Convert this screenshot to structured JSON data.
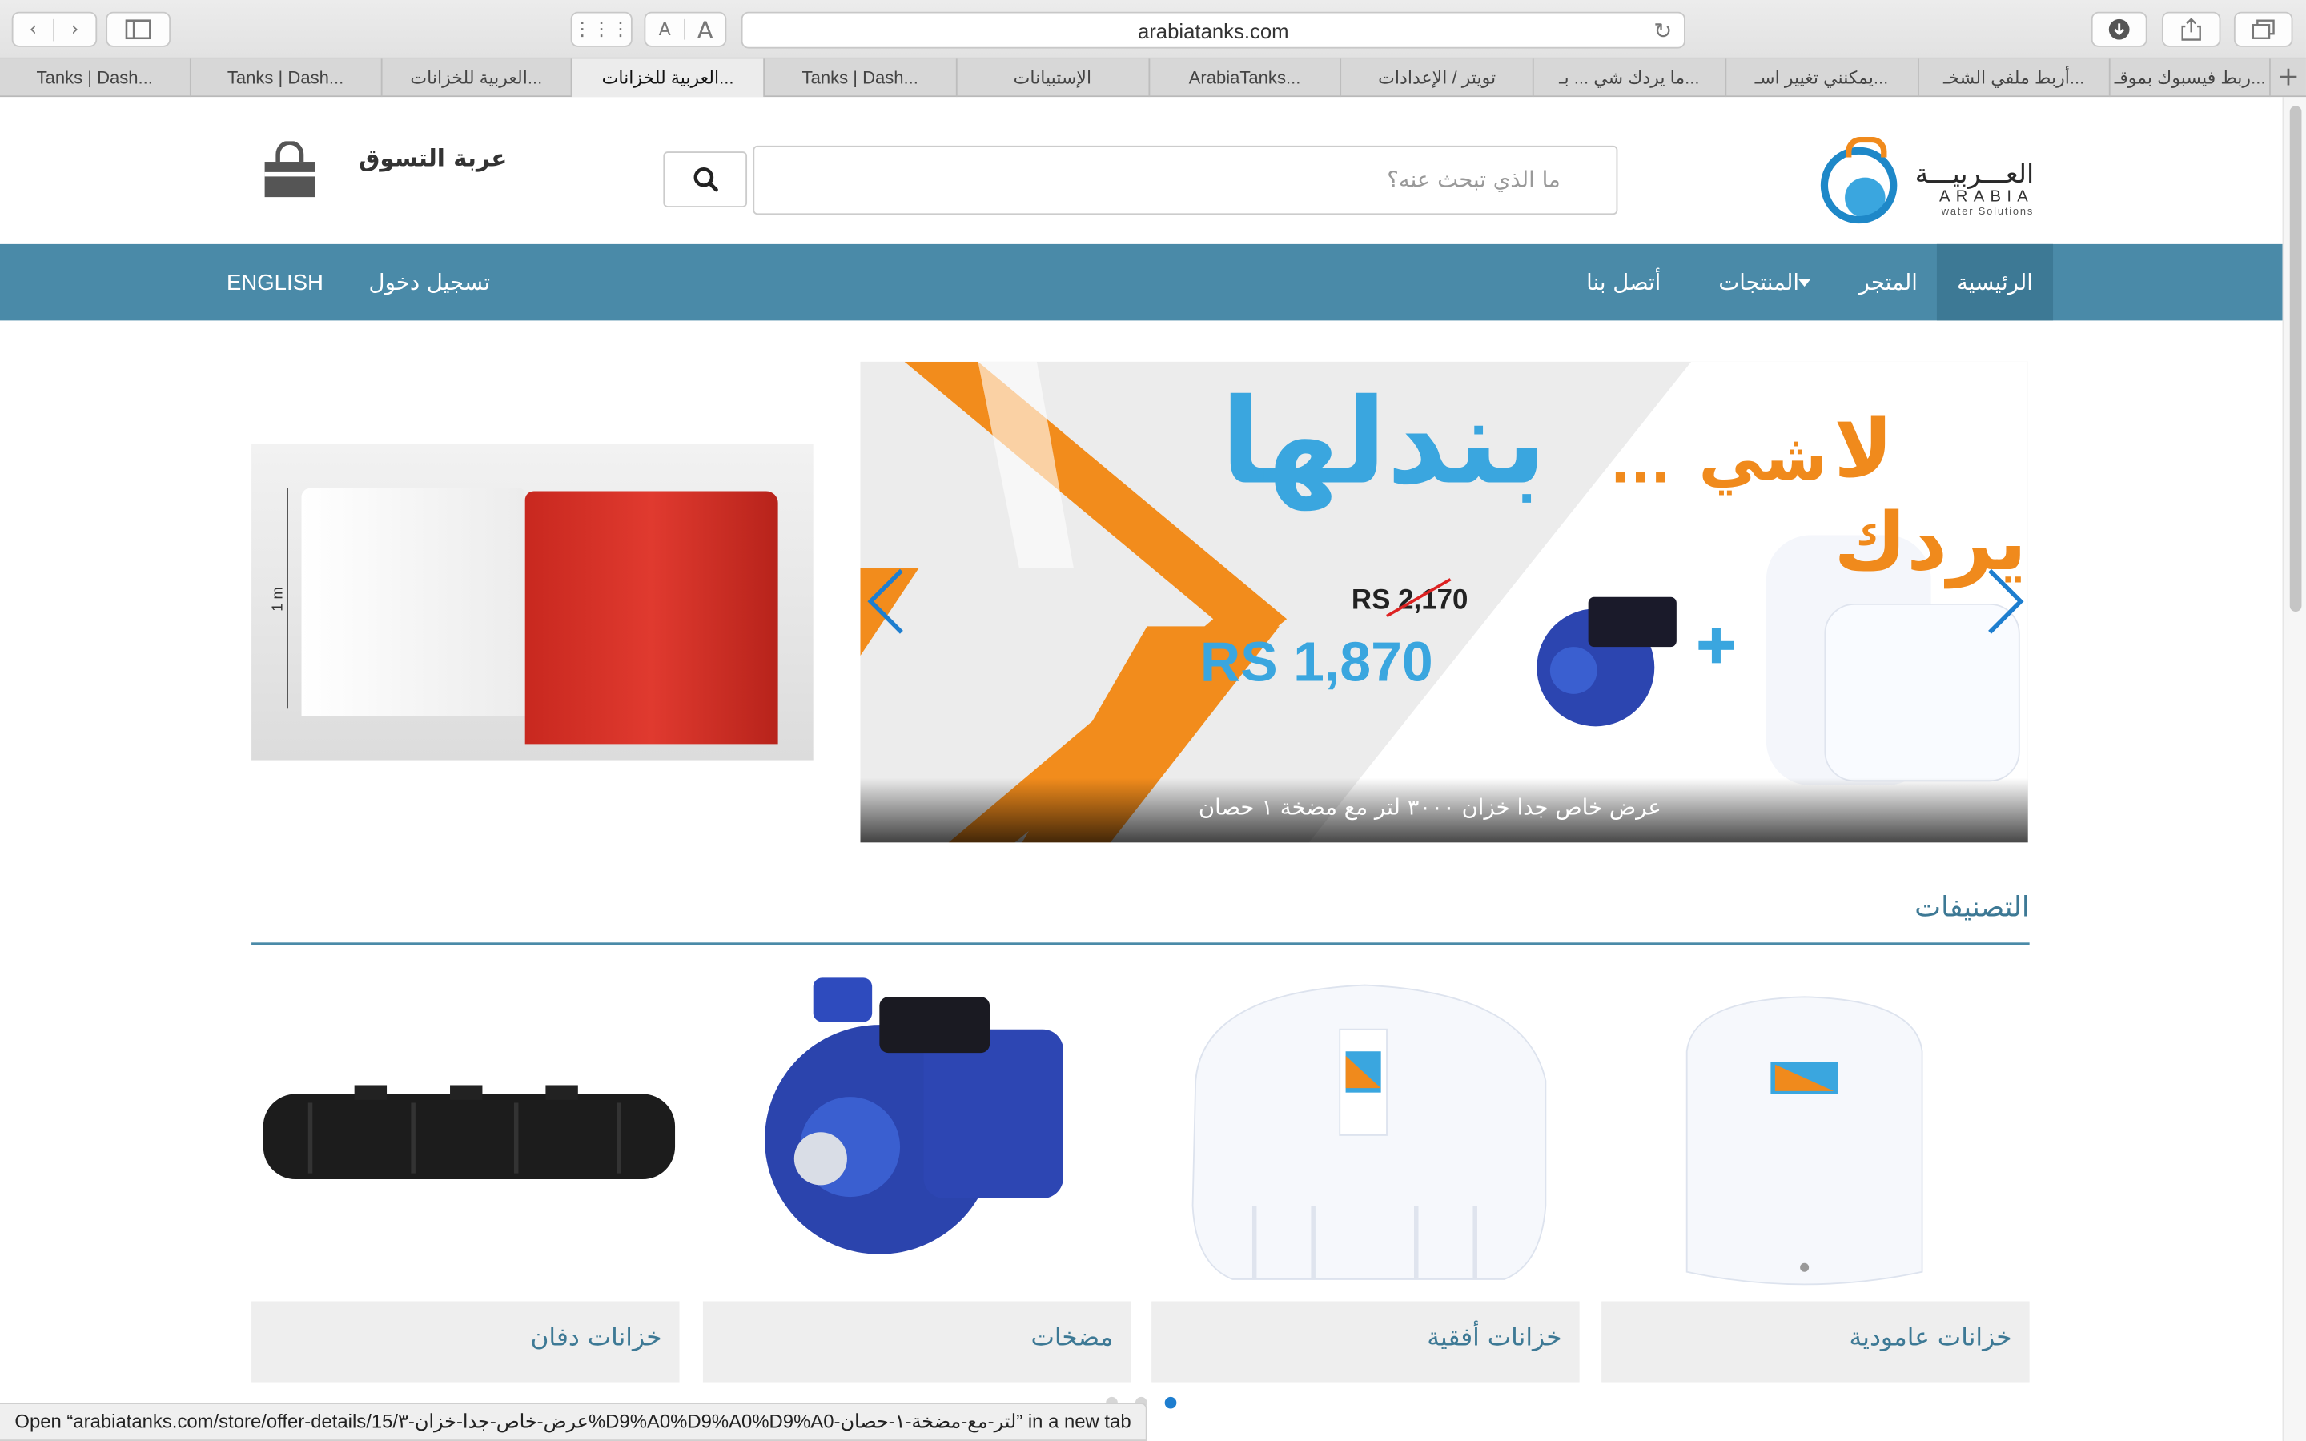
{
  "browser": {
    "url": "arabiatanks.com",
    "text_size_small": "A",
    "text_size_large": "A",
    "tabs": [
      {
        "label": "Tanks | Dash..."
      },
      {
        "label": "Tanks | Dash..."
      },
      {
        "label": "العربية للخزانات..."
      },
      {
        "label": "العربية للخزانات...",
        "active": true
      },
      {
        "label": "Tanks | Dash..."
      },
      {
        "label": "الإستبيانات"
      },
      {
        "label": "ArabiaTanks..."
      },
      {
        "label": "تويتر / الإعدادات"
      },
      {
        "label": "ما يردك شي ... بـ..."
      },
      {
        "label": "يمكنني تغيير اسـ..."
      },
      {
        "label": "أربط ملفي الشخـ..."
      },
      {
        "label": "ربط فيسبوك بموقـ..."
      }
    ],
    "status_text": "Open “arabiatanks.com/store/offer-details/15/عرض-خاص-جدا-خزان-٣%D9%A0%D9%A0%D9%A0-لتر-مع-مضخة-١-حصان” in a new tab"
  },
  "header": {
    "logo_ar": "العـــربيـــة",
    "logo_en": "ARABIA",
    "logo_sub": "water Solutions",
    "search_placeholder": "ما الذي تبحث عنه؟",
    "cart_label": "عربة التسوق"
  },
  "nav": {
    "items": [
      "الرئيسية",
      "المتجر",
      "المنتجات",
      "أتصل بنا"
    ],
    "login": "تسجيل دخول",
    "language": "ENGLISH"
  },
  "banner": {
    "headline": "بندلها",
    "dots": "...",
    "word1": "شي",
    "word2": "لا يردك",
    "old_price": "RS 2,170",
    "new_price": "RS 1,870",
    "caption": "عرض خاص جدا خزان ٣٠٠٠ لتر مع مضخة ١ حصان",
    "side_measure": "1 m"
  },
  "categories": {
    "title": "التصنيفات",
    "items": [
      {
        "label": "خزانات عامودية"
      },
      {
        "label": "خزانات أفقية"
      },
      {
        "label": "مضخات"
      },
      {
        "label": "خزانات دفان"
      }
    ]
  },
  "colors": {
    "nav_bg": "#4a8aa8",
    "accent_blue": "#3aa6df",
    "accent_orange": "#f08a1c",
    "title_blue": "#3d7995"
  }
}
